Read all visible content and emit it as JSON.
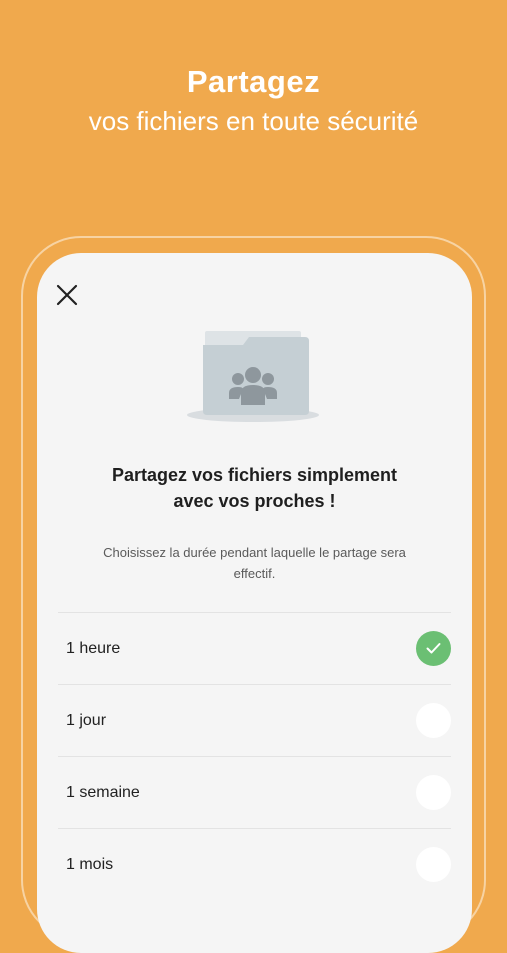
{
  "promo": {
    "title": "Partagez",
    "subtitle": "vos fichiers en toute sécurité"
  },
  "dialog": {
    "close_icon": "close-icon",
    "illustration_icon": "shared-folder-icon",
    "heading_line1": "Partagez vos fichiers simplement",
    "heading_line2": "avec vos proches !",
    "description_line1": "Choisissez la durée pendant laquelle le partage sera",
    "description_line2": "effectif.",
    "options": [
      {
        "label": "1 heure",
        "selected": true
      },
      {
        "label": "1 jour",
        "selected": false
      },
      {
        "label": "1 semaine",
        "selected": false
      },
      {
        "label": "1 mois",
        "selected": false
      }
    ]
  },
  "colors": {
    "background": "#F0A94D",
    "screen": "#F5F5F5",
    "selected": "#6BBF73",
    "folder": "#C5CFD4"
  }
}
